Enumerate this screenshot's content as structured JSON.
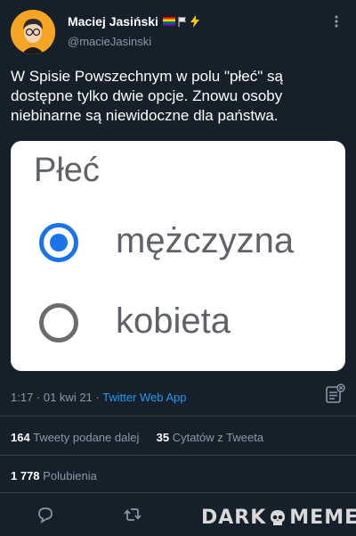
{
  "author": {
    "name": "Maciej Jasiński",
    "handle": "@macieJasinski"
  },
  "tweet": {
    "text": "W Spisie Powszechnym w polu \"płeć\" są dostępne tylko dwie opcje. Znowu osoby niebinarne są niewidoczne dla państwa."
  },
  "media": {
    "title": "Płeć",
    "options": [
      {
        "label": "mężczyzna",
        "selected": true
      },
      {
        "label": "kobieta",
        "selected": false
      }
    ]
  },
  "meta": {
    "time": "1:17 · 01 kwi 21 · ",
    "app": "Twitter Web App"
  },
  "stats": {
    "retweets_count": "164",
    "retweets_label": "Tweety podane dalej",
    "quotes_count": "35",
    "quotes_label": "Cytatów z Tweeta",
    "likes_count": "1 778",
    "likes_label": "Polubienia"
  },
  "watermark": {
    "left": "DARK",
    "right": "MEMES"
  },
  "colors": {
    "background": "#15202b",
    "link": "#1d9bf0",
    "muted": "#8b98a5",
    "radio_selected": "#1a73e8"
  },
  "icons": {
    "badges": [
      "rainbow-flag-icon",
      "white-flag-icon",
      "lightning-icon"
    ],
    "actions": [
      "reply-icon",
      "retweet-icon",
      "like-icon",
      "share-icon"
    ]
  }
}
